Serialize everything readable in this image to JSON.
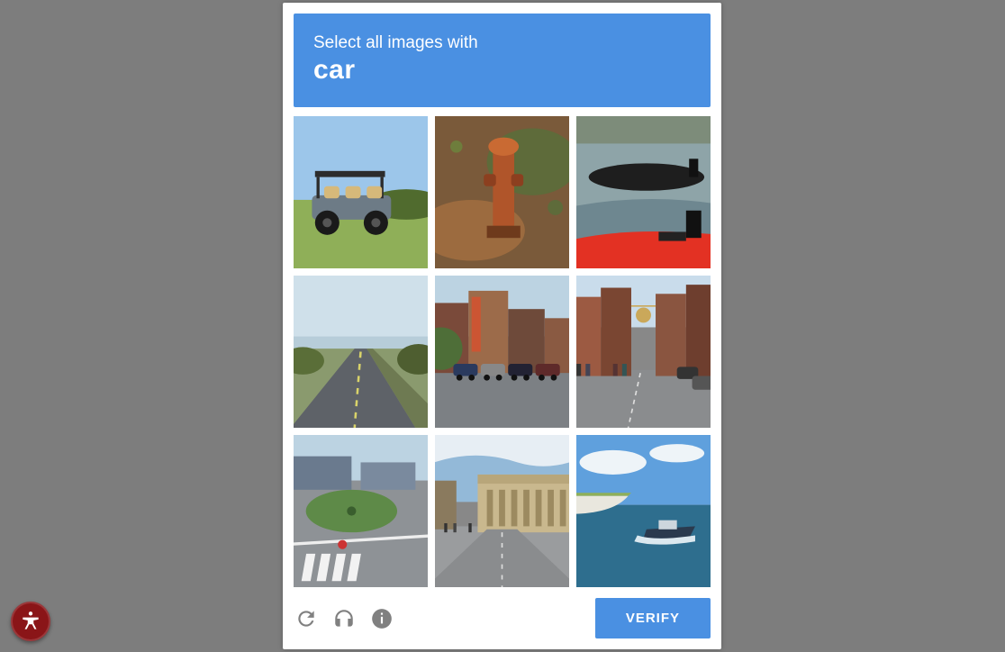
{
  "header": {
    "instruction_prefix": "Select all images with",
    "target_word": "car"
  },
  "grid": {
    "rows": 3,
    "cols": 3,
    "tiles": [
      {
        "idx": 0,
        "alt": "golf cart on grass field under blue sky"
      },
      {
        "idx": 1,
        "alt": "rusty fire hydrant in dirt with leaves"
      },
      {
        "idx": 2,
        "alt": "black inflatable boat and red boat on water near shore"
      },
      {
        "idx": 3,
        "alt": "empty highway with coastline in distance"
      },
      {
        "idx": 4,
        "alt": "downtown street with parked cars and storefronts"
      },
      {
        "idx": 5,
        "alt": "busy city street with pedestrians, flags and parked cars"
      },
      {
        "idx": 6,
        "alt": "suburban roundabout with crosswalk and houses"
      },
      {
        "idx": 7,
        "alt": "wide boulevard with classical building and people"
      },
      {
        "idx": 8,
        "alt": "speedboat on blue sea near white cliffs"
      }
    ]
  },
  "footer": {
    "reload_tooltip": "Get a new challenge",
    "audio_tooltip": "Get an audio challenge",
    "info_tooltip": "Help",
    "verify_label": "VERIFY"
  },
  "accessibility_button_tooltip": "Accessibility options"
}
